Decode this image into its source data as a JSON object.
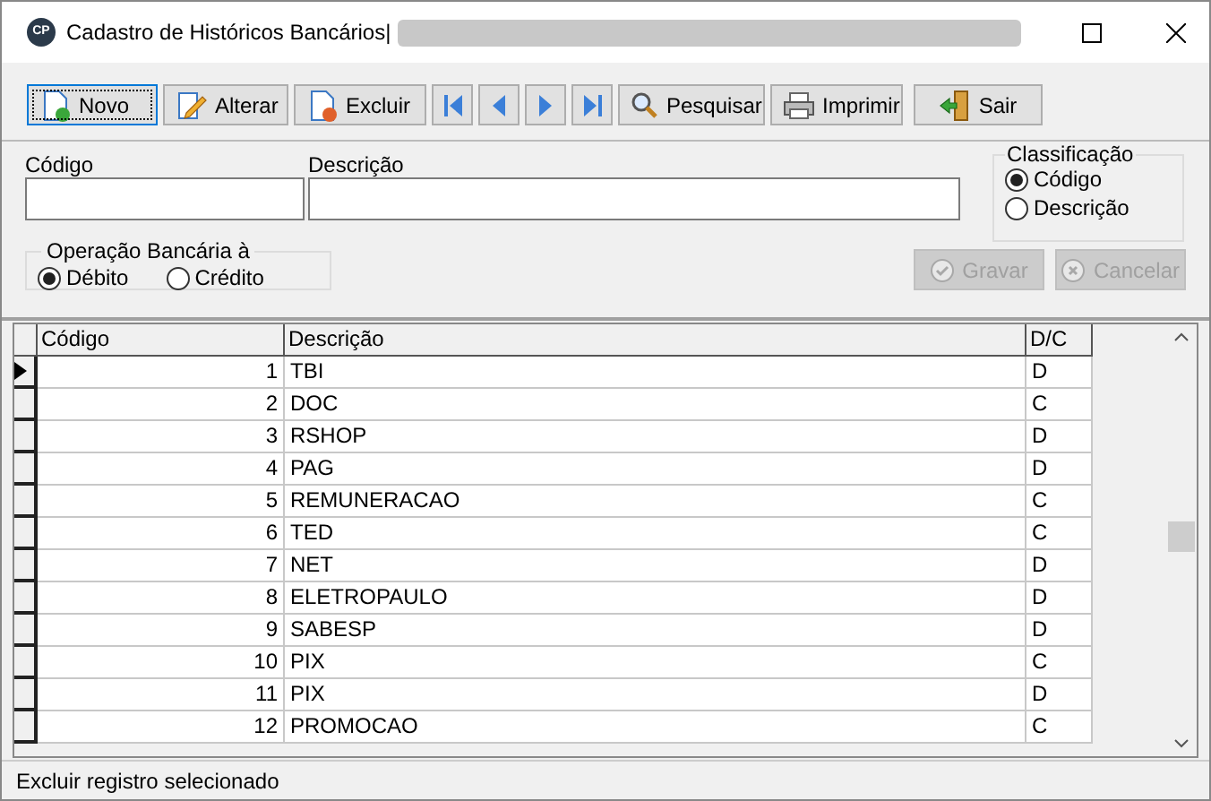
{
  "window": {
    "logo": "CP",
    "title": "Cadastro de Históricos Bancários|"
  },
  "toolbar": [
    {
      "kind": "action",
      "label": "Novo",
      "focused": true
    },
    {
      "kind": "action",
      "label": "Alterar",
      "focused": false
    },
    {
      "kind": "action",
      "label": "Excluir",
      "focused": false
    },
    {
      "kind": "nav",
      "focused": false
    },
    {
      "kind": "nav",
      "focused": false
    },
    {
      "kind": "nav",
      "focused": false
    },
    {
      "kind": "nav",
      "focused": false
    },
    {
      "kind": "action",
      "label": "Pesquisar",
      "focused": false
    },
    {
      "kind": "action",
      "label": "Imprimir",
      "focused": false
    },
    {
      "kind": "action",
      "label": "Sair",
      "focused": false
    }
  ],
  "form": {
    "codigo_label": "Código",
    "descricao_label": "Descrição",
    "classificacao": {
      "title": "Classificação",
      "options": [
        {
          "label": "Código",
          "selected": true
        },
        {
          "label": "Descrição",
          "selected": false
        }
      ]
    },
    "operacao": {
      "title": "Operação Bancária à",
      "options": [
        {
          "label": "Débito",
          "selected": true
        },
        {
          "label": "Crédito",
          "selected": false
        }
      ]
    },
    "buttons": [
      {
        "label": "Gravar",
        "disabled": true
      },
      {
        "label": "Cancelar",
        "disabled": true
      }
    ]
  },
  "table": {
    "columns": [
      "Código",
      "Descrição",
      "D/C"
    ],
    "rows": [
      {
        "codigo": "1",
        "descricao": "TBI",
        "dc": "D",
        "selected": true
      },
      {
        "codigo": "2",
        "descricao": "DOC",
        "dc": "C",
        "selected": false
      },
      {
        "codigo": "3",
        "descricao": "RSHOP",
        "dc": "D",
        "selected": false
      },
      {
        "codigo": "4",
        "descricao": "PAG",
        "dc": "D",
        "selected": false
      },
      {
        "codigo": "5",
        "descricao": "REMUNERACAO",
        "dc": "C",
        "selected": false
      },
      {
        "codigo": "6",
        "descricao": "TED",
        "dc": "C",
        "selected": false
      },
      {
        "codigo": "7",
        "descricao": "NET",
        "dc": "D",
        "selected": false
      },
      {
        "codigo": "8",
        "descricao": "ELETROPAULO",
        "dc": "D",
        "selected": false
      },
      {
        "codigo": "9",
        "descricao": "SABESP",
        "dc": "D",
        "selected": false
      },
      {
        "codigo": "10",
        "descricao": "PIX",
        "dc": "C",
        "selected": false
      },
      {
        "codigo": "11",
        "descricao": "PIX",
        "dc": "D",
        "selected": false
      },
      {
        "codigo": "12",
        "descricao": "PROMOCAO",
        "dc": "C",
        "selected": false
      }
    ]
  },
  "status_bar": "Excluir registro selecionado"
}
